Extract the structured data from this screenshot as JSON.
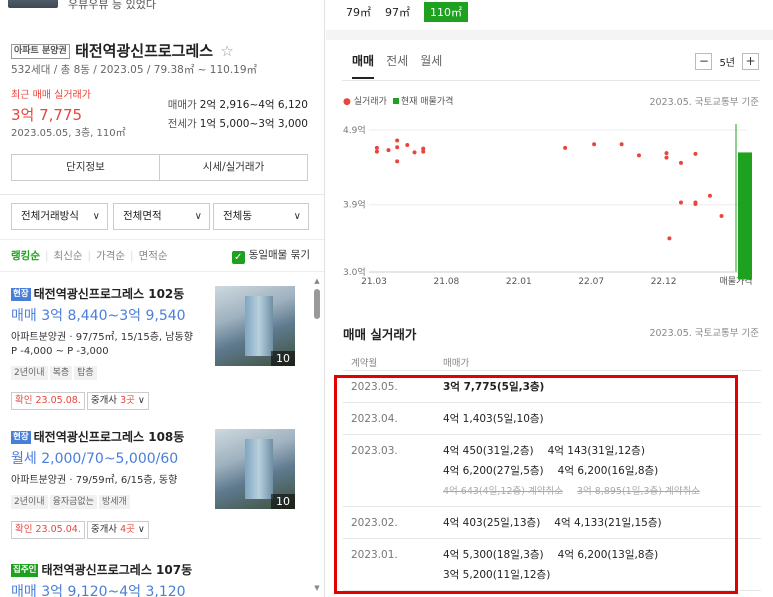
{
  "top": {
    "partial_text": "우뷰우뷰 등 있었다"
  },
  "complex": {
    "badge": "아파트 분양권",
    "name": "태전역광신프로그레스",
    "star": "☆",
    "info": "532세대 / 총 8동 / 2023.05 / 79.38㎡ ~ 110.19㎡",
    "recent_label": "최근 매매 실거래가",
    "recent_price": "3억 7,775",
    "recent_date": "2023.05.05, 3층, 110㎡",
    "sale_key": "매매가",
    "sale_val": "2억 2,916~4억 6,120",
    "jeonse_key": "전세가",
    "jeonse_val": "1억 5,000~3억 3,000",
    "btn_info": "단지정보",
    "btn_price": "시세/실거래가"
  },
  "filters": {
    "f1": "전체거래방식",
    "f2": "전체면적",
    "f3": "전체동",
    "chev": "∨"
  },
  "sorts": [
    "랭킹순",
    "최신순",
    "가격순",
    "면적순"
  ],
  "same_listing": "동일매물 묶기",
  "listings": [
    {
      "badge": "현장",
      "title": "태전역광신프로그레스 102동",
      "price": "매매 3억 8,440~3억 9,540",
      "desc": "아파트분양권 · 97/75㎡, 15/15층, 남동향",
      "sub": "P -4,000 ~ P -3,000",
      "tags": [
        "2년이내",
        "복층",
        "탑층"
      ],
      "confirm": "확인 23.05.08.",
      "agent_pre": "중개사 ",
      "agent_cnt": "3곳",
      "agent_post": " ∨",
      "photo_count": "10"
    },
    {
      "badge": "현장",
      "title": "태전역광신프로그레스 108동",
      "price": "월세 2,000/70~5,000/60",
      "desc": "아파트분양권 · 79/59㎡, 6/15층, 동향",
      "tags": [
        "2년이내",
        "융자금없는",
        "방세개"
      ],
      "confirm": "확인 23.05.04.",
      "agent_pre": "중개사 ",
      "agent_cnt": "4곳",
      "agent_post": " ∨",
      "photo_count": "10"
    },
    {
      "badge": "집주인",
      "title": "태전역광신프로그레스 107동",
      "price": "매매 3억 9,120~4억 3,120"
    }
  ],
  "sizes": [
    "79㎡",
    "97㎡",
    "110㎡"
  ],
  "tabs": [
    "매매",
    "전세",
    "월세"
  ],
  "year_ctl": {
    "minus": "−",
    "label": "5년",
    "plus": "+"
  },
  "legend": {
    "actual": "실거래가",
    "current": "현재 매물가격"
  },
  "source": "2023.05. 국토교통부 기준",
  "chart_data": {
    "type": "scatter",
    "y_ticks": [
      "4.9억",
      "3.9억",
      "3.0억"
    ],
    "y_values": [
      4.9,
      3.9,
      3.0
    ],
    "x_ticks": [
      "21.03",
      "21.08",
      "22.01",
      "22.07",
      "22.12",
      "매물가격"
    ],
    "series": [
      {
        "name": "실거래가",
        "color": "#e8463c",
        "points": [
          [
            0.2,
            4.66
          ],
          [
            0.2,
            4.61
          ],
          [
            1.0,
            4.63
          ],
          [
            1.6,
            4.76
          ],
          [
            1.6,
            4.67
          ],
          [
            1.6,
            4.48
          ],
          [
            2.3,
            4.7
          ],
          [
            2.8,
            4.6
          ],
          [
            3.4,
            4.65
          ],
          [
            3.4,
            4.61
          ],
          [
            13.2,
            4.66
          ],
          [
            15.2,
            4.71
          ],
          [
            17.1,
            4.71
          ],
          [
            18.3,
            4.56
          ],
          [
            20.2,
            4.59
          ],
          [
            20.2,
            4.53
          ],
          [
            20.4,
            3.45
          ],
          [
            21.2,
            4.46
          ],
          [
            22.2,
            4.58
          ],
          [
            21.2,
            3.93
          ],
          [
            22.2,
            3.93
          ],
          [
            22.2,
            3.91
          ],
          [
            23.2,
            4.02
          ],
          [
            24.0,
            3.75
          ]
        ]
      }
    ],
    "listing_range": {
      "name": "현재 매물가격",
      "color": "#1ea11e",
      "min": 2.9,
      "max": 4.6
    },
    "ylim": [
      3.0,
      5.0
    ]
  },
  "deals_title": "매매 실거래가",
  "table_head": {
    "date": "계약월",
    "price": "매매가"
  },
  "deals": [
    {
      "date": "2023.05.",
      "lines": [
        [
          "3억 7,775(5일,3층)"
        ]
      ],
      "bold": true
    },
    {
      "date": "2023.04.",
      "lines": [
        [
          "4억 1,403(5일,10층)"
        ]
      ]
    },
    {
      "date": "2023.03.",
      "lines": [
        [
          "4억 450(31일,2층)",
          "4억 143(31일,12층)"
        ],
        [
          "4억 6,200(27일,5층)",
          "4억 6,200(16일,8층)"
        ]
      ],
      "strike": [
        "4억 643(4일,12층) 계약취소",
        "3억 8,895(1일,3층) 계약취소"
      ]
    },
    {
      "date": "2023.02.",
      "lines": [
        [
          "4억 403(25일,13층)",
          "4억 4,133(21일,15층)"
        ]
      ]
    },
    {
      "date": "2023.01.",
      "lines": [
        [
          "4억 5,300(18일,3층)",
          "4억 6,200(13일,8층)"
        ],
        [
          "3억 5,200(11일,12층)"
        ]
      ]
    }
  ]
}
